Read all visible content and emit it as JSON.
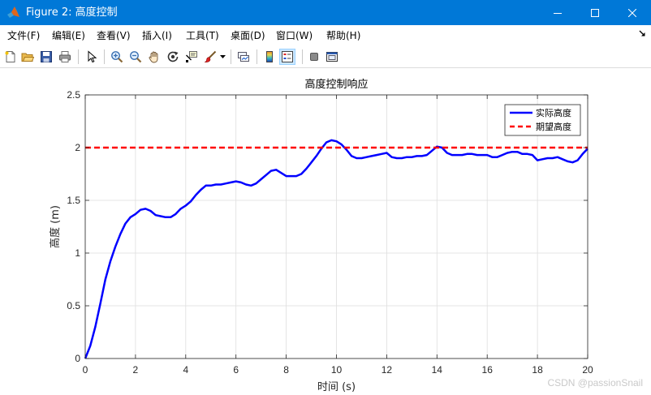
{
  "window": {
    "title": "Figure 2: 高度控制",
    "titlebar_color": "#0078d7"
  },
  "menu": {
    "items": [
      "文件(F)",
      "编辑(E)",
      "查看(V)",
      "插入(I)",
      "工具(T)",
      "桌面(D)",
      "窗口(W)",
      "帮助(H)"
    ]
  },
  "toolbar": {
    "icons": [
      "new-figure-icon",
      "open-file-icon",
      "save-icon",
      "print-icon",
      "pointer-icon",
      "zoom-in-icon",
      "zoom-out-icon",
      "pan-icon",
      "rotate-3d-icon",
      "data-cursor-icon",
      "brush-icon",
      "link-plot-icon",
      "colorbar-icon",
      "legend-icon",
      "hide-tools-icon",
      "show-tools-icon"
    ]
  },
  "watermark": "CSDN @passionSnail",
  "chart_data": {
    "type": "line",
    "title": "高度控制响应",
    "xlabel": "时间 (s)",
    "ylabel": "高度 (m)",
    "xlim": [
      0,
      20
    ],
    "ylim": [
      0,
      2.5
    ],
    "xticks": [
      "0",
      "2",
      "4",
      "6",
      "8",
      "10",
      "12",
      "14",
      "16",
      "18",
      "20"
    ],
    "yticks": [
      "0",
      "0.5",
      "1",
      "1.5",
      "2",
      "2.5"
    ],
    "grid": true,
    "legend_position": "top-right",
    "series": [
      {
        "name": "实际高度",
        "color": "#0000ff",
        "style": "solid",
        "x": [
          0,
          0.2,
          0.4,
          0.6,
          0.8,
          1.0,
          1.2,
          1.4,
          1.6,
          1.8,
          2.0,
          2.2,
          2.4,
          2.6,
          2.8,
          3.0,
          3.2,
          3.4,
          3.6,
          3.8,
          4.0,
          4.2,
          4.4,
          4.6,
          4.8,
          5.0,
          5.2,
          5.4,
          5.6,
          5.8,
          6.0,
          6.2,
          6.4,
          6.6,
          6.8,
          7.0,
          7.2,
          7.4,
          7.6,
          7.8,
          8.0,
          8.2,
          8.4,
          8.6,
          8.8,
          9.0,
          9.2,
          9.4,
          9.6,
          9.8,
          10.0,
          10.2,
          10.4,
          10.6,
          10.8,
          11.0,
          11.2,
          11.4,
          11.6,
          11.8,
          12.0,
          12.2,
          12.4,
          12.6,
          12.8,
          13.0,
          13.2,
          13.4,
          13.6,
          13.8,
          14.0,
          14.2,
          14.4,
          14.6,
          14.8,
          15.0,
          15.2,
          15.4,
          15.6,
          15.8,
          16.0,
          16.2,
          16.4,
          16.6,
          16.8,
          17.0,
          17.2,
          17.4,
          17.6,
          17.8,
          18.0,
          18.2,
          18.4,
          18.6,
          18.8,
          19.0,
          19.2,
          19.4,
          19.6,
          19.8,
          20.0
        ],
        "y": [
          0.0,
          0.12,
          0.3,
          0.52,
          0.75,
          0.92,
          1.06,
          1.18,
          1.28,
          1.34,
          1.37,
          1.41,
          1.42,
          1.4,
          1.36,
          1.35,
          1.34,
          1.34,
          1.37,
          1.42,
          1.45,
          1.49,
          1.55,
          1.6,
          1.64,
          1.64,
          1.65,
          1.65,
          1.66,
          1.67,
          1.68,
          1.67,
          1.65,
          1.64,
          1.66,
          1.7,
          1.74,
          1.78,
          1.79,
          1.76,
          1.73,
          1.73,
          1.73,
          1.75,
          1.8,
          1.86,
          1.92,
          1.99,
          2.05,
          2.07,
          2.06,
          2.03,
          1.98,
          1.92,
          1.9,
          1.9,
          1.91,
          1.92,
          1.93,
          1.94,
          1.95,
          1.91,
          1.9,
          1.9,
          1.91,
          1.91,
          1.92,
          1.92,
          1.93,
          1.97,
          2.01,
          2.0,
          1.95,
          1.93,
          1.93,
          1.93,
          1.94,
          1.94,
          1.93,
          1.93,
          1.93,
          1.91,
          1.91,
          1.93,
          1.95,
          1.96,
          1.96,
          1.94,
          1.94,
          1.93,
          1.88,
          1.89,
          1.9,
          1.9,
          1.91,
          1.89,
          1.87,
          1.86,
          1.88,
          1.94,
          1.99
        ]
      },
      {
        "name": "期望高度",
        "color": "#ff0000",
        "style": "dashed",
        "x": [
          0,
          20
        ],
        "y": [
          2,
          2
        ]
      }
    ]
  }
}
